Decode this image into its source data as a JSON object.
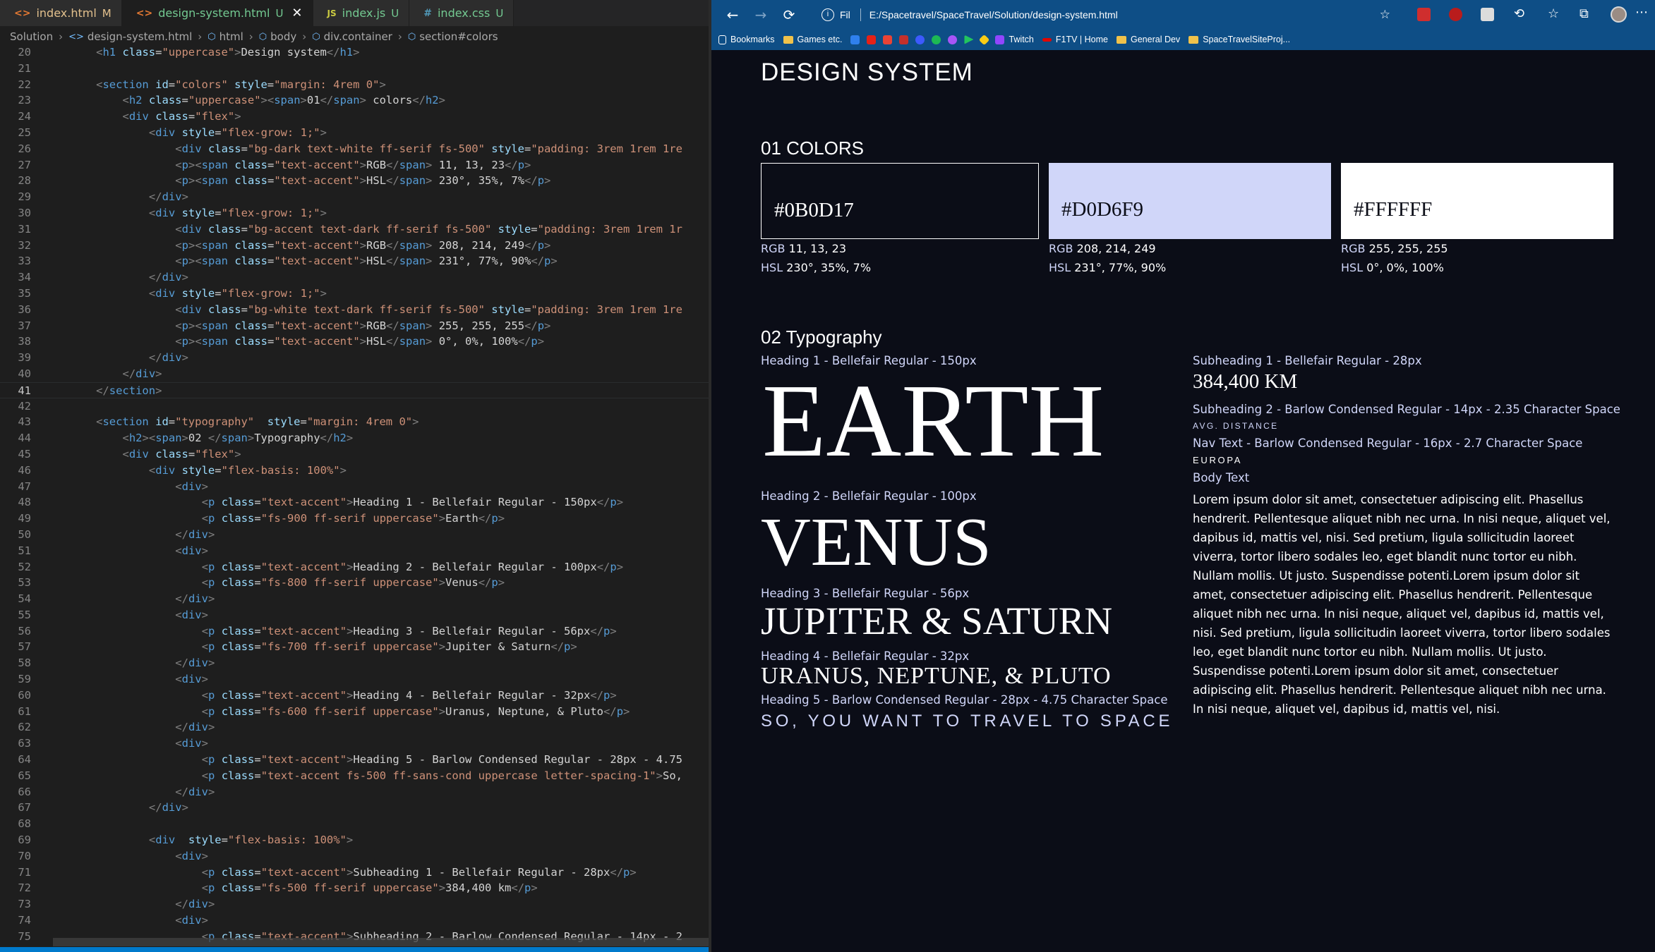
{
  "editor": {
    "tabs": [
      {
        "icon": "<>",
        "name": "index.html",
        "status": "M"
      },
      {
        "icon": "<>",
        "name": "design-system.html",
        "status": "U",
        "active": true
      },
      {
        "icon": "JS",
        "name": "index.js",
        "status": "U"
      },
      {
        "icon": "#",
        "name": "index.css",
        "status": "U"
      }
    ],
    "breadcrumb": [
      "Solution",
      "design-system.html",
      "html",
      "body",
      "div.container",
      "section#colors"
    ],
    "code_lines": [
      {
        "n": "20",
        "text": "<h1 class=\"uppercase\">Design system</h1>",
        "indent": 6
      },
      {
        "n": "21",
        "text": "",
        "indent": 0
      },
      {
        "n": "22",
        "text": "<section id=\"colors\" style=\"margin: 4rem 0\">",
        "indent": 6
      },
      {
        "n": "23",
        "text": "<h2 class=\"uppercase\"><span>01</span> colors</h2>",
        "indent": 10
      },
      {
        "n": "24",
        "text": "<div class=\"flex\">",
        "indent": 10
      },
      {
        "n": "25",
        "text": "<div style=\"flex-grow: 1;\">",
        "indent": 14
      },
      {
        "n": "26",
        "text": "<div class=\"bg-dark text-white ff-serif fs-500\" style=\"padding: 3rem 1rem 1re",
        "indent": 18
      },
      {
        "n": "27",
        "text": "<p><span class=\"text-accent\">RGB</span> 11, 13, 23</p>",
        "indent": 18
      },
      {
        "n": "28",
        "text": "<p><span class=\"text-accent\">HSL</span> 230°, 35%, 7%</p>",
        "indent": 18
      },
      {
        "n": "29",
        "text": "</div>",
        "indent": 14
      },
      {
        "n": "30",
        "text": "<div style=\"flex-grow: 1;\">",
        "indent": 14
      },
      {
        "n": "31",
        "text": "<div class=\"bg-accent text-dark ff-serif fs-500\" style=\"padding: 3rem 1rem 1r",
        "indent": 18
      },
      {
        "n": "32",
        "text": "<p><span class=\"text-accent\">RGB</span> 208, 214, 249</p>",
        "indent": 18
      },
      {
        "n": "33",
        "text": "<p><span class=\"text-accent\">HSL</span> 231°, 77%, 90%</p>",
        "indent": 18
      },
      {
        "n": "34",
        "text": "</div>",
        "indent": 14
      },
      {
        "n": "35",
        "text": "<div style=\"flex-grow: 1;\">",
        "indent": 14
      },
      {
        "n": "36",
        "text": "<div class=\"bg-white text-dark ff-serif fs-500\" style=\"padding: 3rem 1rem 1re",
        "indent": 18
      },
      {
        "n": "37",
        "text": "<p><span class=\"text-accent\">RGB</span> 255, 255, 255</p>",
        "indent": 18
      },
      {
        "n": "38",
        "text": "<p><span class=\"text-accent\">HSL</span> 0°, 0%, 100%</p>",
        "indent": 18
      },
      {
        "n": "39",
        "text": "</div>",
        "indent": 14
      },
      {
        "n": "40",
        "text": "</div>",
        "indent": 10
      },
      {
        "n": "41",
        "text": "</section>",
        "indent": 6,
        "current": true
      },
      {
        "n": "42",
        "text": "",
        "indent": 0
      },
      {
        "n": "43",
        "text": "<section id=\"typography\"  style=\"margin: 4rem 0\">",
        "indent": 6
      },
      {
        "n": "44",
        "text": "<h2><span>02 </span>Typography</h2>",
        "indent": 10
      },
      {
        "n": "45",
        "text": "<div class=\"flex\">",
        "indent": 10
      },
      {
        "n": "46",
        "text": "<div style=\"flex-basis: 100%\">",
        "indent": 14
      },
      {
        "n": "47",
        "text": "<div>",
        "indent": 18
      },
      {
        "n": "48",
        "text": "<p class=\"text-accent\">Heading 1 - Bellefair Regular - 150px</p>",
        "indent": 22
      },
      {
        "n": "49",
        "text": "<p class=\"fs-900 ff-serif uppercase\">Earth</p>",
        "indent": 22
      },
      {
        "n": "50",
        "text": "</div>",
        "indent": 18
      },
      {
        "n": "51",
        "text": "<div>",
        "indent": 18
      },
      {
        "n": "52",
        "text": "<p class=\"text-accent\">Heading 2 - Bellefair Regular - 100px</p>",
        "indent": 22
      },
      {
        "n": "53",
        "text": "<p class=\"fs-800 ff-serif uppercase\">Venus</p>",
        "indent": 22
      },
      {
        "n": "54",
        "text": "</div>",
        "indent": 18
      },
      {
        "n": "55",
        "text": "<div>",
        "indent": 18
      },
      {
        "n": "56",
        "text": "<p class=\"text-accent\">Heading 3 - Bellefair Regular - 56px</p>",
        "indent": 22
      },
      {
        "n": "57",
        "text": "<p class=\"fs-700 ff-serif uppercase\">Jupiter & Saturn</p>",
        "indent": 22
      },
      {
        "n": "58",
        "text": "</div>",
        "indent": 18
      },
      {
        "n": "59",
        "text": "<div>",
        "indent": 18
      },
      {
        "n": "60",
        "text": "<p class=\"text-accent\">Heading 4 - Bellefair Regular - 32px</p>",
        "indent": 22
      },
      {
        "n": "61",
        "text": "<p class=\"fs-600 ff-serif uppercase\">Uranus, Neptune, & Pluto</p>",
        "indent": 22
      },
      {
        "n": "62",
        "text": "</div>",
        "indent": 18
      },
      {
        "n": "63",
        "text": "<div>",
        "indent": 18
      },
      {
        "n": "64",
        "text": "<p class=\"text-accent\">Heading 5 - Barlow Condensed Regular - 28px - 4.75",
        "indent": 22
      },
      {
        "n": "65",
        "text": "<p class=\"text-accent fs-500 ff-sans-cond uppercase letter-spacing-1\">So,",
        "indent": 22
      },
      {
        "n": "66",
        "text": "</div>",
        "indent": 18
      },
      {
        "n": "67",
        "text": "</div>",
        "indent": 14
      },
      {
        "n": "68",
        "text": "",
        "indent": 0
      },
      {
        "n": "69",
        "text": "<div  style=\"flex-basis: 100%\">",
        "indent": 14
      },
      {
        "n": "70",
        "text": "<div>",
        "indent": 18
      },
      {
        "n": "71",
        "text": "<p class=\"text-accent\">Subheading 1 - Bellefair Regular - 28px</p>",
        "indent": 22
      },
      {
        "n": "72",
        "text": "<p class=\"fs-500 ff-serif uppercase\">384,400 km</p>",
        "indent": 22
      },
      {
        "n": "73",
        "text": "</div>",
        "indent": 18
      },
      {
        "n": "74",
        "text": "<div>",
        "indent": 18
      },
      {
        "n": "75",
        "text": "<p class=\"text-accent\">Subheading 2 - Barlow Condensed Regular - 14px - 2",
        "indent": 22
      }
    ]
  },
  "browser": {
    "nav": {
      "back": "←",
      "forward": "→",
      "reload": "⟳"
    },
    "url": {
      "scheme_label": "Fil",
      "path": "E:/Spacetravel/SpaceTravel/Solution/design-system.html",
      "info_glyph": "i",
      "star_glyph": "☆"
    },
    "bookmarks": [
      {
        "label": "Bookmarks",
        "kind": "text"
      },
      {
        "label": "Games etc.",
        "kind": "folder"
      },
      {
        "label": "Twitch",
        "kind": "text"
      },
      {
        "label": "F1TV | Home",
        "kind": "text"
      },
      {
        "label": "General Dev",
        "kind": "folder"
      },
      {
        "label": "SpaceTravelSiteProj...",
        "kind": "folder"
      }
    ],
    "bookmark_icon_colors": [
      "#2f80ed",
      "#e62117",
      "#ea4335",
      "#c4302b",
      "#3d5afe",
      "#1db954",
      "#a855f7",
      "#22c55e",
      "#facc15"
    ]
  },
  "page": {
    "title": "DESIGN SYSTEM",
    "colors_title": "01 COLORS",
    "swatches": [
      {
        "hex": "#0B0D17",
        "rgb": "11, 13, 23",
        "hsl": "230°, 35%, 7%",
        "bg": "#0b0d17",
        "fg": "#ffffff"
      },
      {
        "hex": "#D0D6F9",
        "rgb": "208, 214, 249",
        "hsl": "231°, 77%, 90%",
        "bg": "#d0d6f9",
        "fg": "#0b0d17"
      },
      {
        "hex": "#FFFFFF",
        "rgb": "255, 255, 255",
        "hsl": "0°, 0%, 100%",
        "bg": "#ffffff",
        "fg": "#0b0d17"
      }
    ],
    "rgb_label": "RGB",
    "hsl_label": "HSL",
    "typography_title": "02 Typography",
    "h1_label": "Heading 1 - Bellefair Regular - 150px",
    "h1_sample": "EARTH",
    "h2_label": "Heading 2 - Bellefair Regular - 100px",
    "h2_sample": "VENUS",
    "h3_label": "Heading 3 - Bellefair Regular - 56px",
    "h3_sample": "JUPITER & SATURN",
    "h4_label": "Heading 4 - Bellefair Regular - 32px",
    "h4_sample": "URANUS, NEPTUNE, & PLUTO",
    "h5_label": "Heading 5 - Barlow Condensed Regular - 28px - 4.75 Character Space",
    "h5_sample": "SO, YOU WANT TO TRAVEL TO SPACE",
    "sub1_label": "Subheading 1 - Bellefair Regular - 28px",
    "sub1_sample": "384,400 KM",
    "sub2_label": "Subheading 2 - Barlow Condensed Regular - 14px - 2.35 Character Space",
    "sub2_sample": "AVG. DISTANCE",
    "nav_label": "Nav Text - Barlow Condensed Regular - 16px - 2.7 Character Space",
    "nav_sample": "EUROPA",
    "body_label": "Body Text",
    "body_text": "Lorem ipsum dolor sit amet, consectetuer adipiscing elit. Phasellus hendrerit. Pellentesque aliquet nibh nec urna. In nisi neque, aliquet vel, dapibus id, mattis vel, nisi. Sed pretium, ligula sollicitudin laoreet viverra, tortor libero sodales leo, eget blandit nunc tortor eu nibh. Nullam mollis. Ut justo. Suspendisse potenti.Lorem ipsum dolor sit amet, consectetuer adipiscing elit. Phasellus hendrerit. Pellentesque aliquet nibh nec urna. In nisi neque, aliquet vel, dapibus id, mattis vel, nisi. Sed pretium, ligula sollicitudin laoreet viverra, tortor libero sodales leo, eget blandit nunc tortor eu nibh. Nullam mollis. Ut justo. Suspendisse potenti.Lorem ipsum dolor sit amet, consectetuer adipiscing elit. Phasellus hendrerit. Pellentesque aliquet nibh nec urna. In nisi neque, aliquet vel, dapibus id, mattis vel, nisi."
  }
}
